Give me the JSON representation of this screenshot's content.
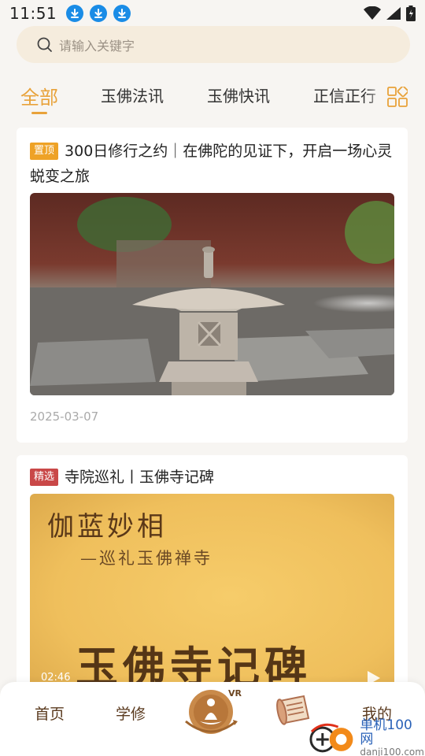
{
  "status_bar": {
    "time": "11:51",
    "download_icon_count": 3
  },
  "search": {
    "placeholder": "请输入关键字"
  },
  "tabs": [
    {
      "label": "全部",
      "active": true
    },
    {
      "label": "玉佛法讯",
      "active": false
    },
    {
      "label": "玉佛快讯",
      "active": false
    },
    {
      "label": "正信正行",
      "active": false
    }
  ],
  "articles": [
    {
      "badge": "置顶",
      "title": "300日修行之约｜在佛陀的见证下，开启一场心灵蜕变之旅",
      "date": "2025-03-07",
      "image": "stone-lantern-garden"
    },
    {
      "badge": "精选",
      "title": "寺院巡礼丨玉佛寺记碑",
      "image": "calligraphy-stele-video",
      "image_text": {
        "line1": "伽蓝妙相",
        "line2": "—巡礼玉佛禅寺",
        "big": "玉佛寺记碑"
      },
      "video_time": "02:46"
    }
  ],
  "bottom_nav": {
    "home": "首页",
    "study": "学修",
    "vr_badge": "VR",
    "mine": "我的"
  },
  "watermark": {
    "name": "单机100网",
    "url": "danji100.com"
  },
  "colors": {
    "accent": "#e8a23a",
    "pin_badge": "#eea226",
    "pick_badge": "#c94848",
    "nav_text": "#5a3a1e"
  }
}
